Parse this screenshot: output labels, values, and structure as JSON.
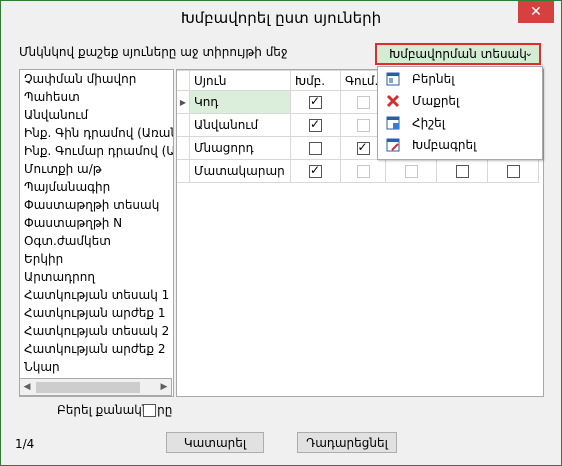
{
  "window": {
    "title": "Խմբավորել ըստ սյուների",
    "close_glyph": "✕"
  },
  "subtitle": "Մնկնկով քաշեք սյուները աջ տիրույթի մեջ",
  "group_type": {
    "label": "Խմբավորման տեսակ",
    "chevron": "⌄"
  },
  "group_menu": [
    {
      "label": "Բերնել",
      "icon": "layout-icon"
    },
    {
      "label": "Մաքրել",
      "icon": "red-x-icon"
    },
    {
      "label": "Հիշել",
      "icon": "save-grid-icon"
    },
    {
      "label": "Խմբագրել",
      "icon": "edit-grid-icon"
    }
  ],
  "left_columns": [
    "Չափման միավոր",
    "Պահեստ",
    "Անվանում",
    "Ինք. Գին դրամով (Առանձ",
    "Ինք. Գումար դրամով (Առ",
    "Մուտքի ա/թ",
    "Պայմանագիր",
    "Փաստաթղթի տեսակ",
    "Փաստաթղթի N",
    "Օգտ.ժամկետ",
    "Երկիր",
    "Արտադրող",
    "Հատկության տեսակ 1",
    "Հատկության արժեք 1",
    "Հատկության տեսակ 2",
    "Հատկության արժեք 2",
    "Նկար"
  ],
  "grid": {
    "headers": [
      "Սյուն",
      "Խմբ.",
      "Գում."
    ],
    "rows": [
      {
        "name": "Կոդ",
        "group": true,
        "sum": false,
        "sum_disabled": true,
        "extra1": false,
        "extra2": false,
        "selected": true
      },
      {
        "name": "Անվանում",
        "group": true,
        "sum": false,
        "sum_disabled": true,
        "extra1": false,
        "extra2": false,
        "selected": false
      },
      {
        "name": "Մնացորդ",
        "group": false,
        "sum": true,
        "sum_disabled": false,
        "extra1": false,
        "extra2": false,
        "selected": false
      },
      {
        "name": "Մատակարար",
        "group": true,
        "sum": false,
        "sum_disabled": true,
        "extra1": false,
        "extra2": false,
        "selected": false
      }
    ],
    "row_indicator": "▶"
  },
  "bring_quantities": {
    "label": "Բերել քանակները",
    "checked": false
  },
  "pager": "1/4",
  "buttons": {
    "ok": "Կատարել",
    "cancel": "Դադարեցնել"
  },
  "colors": {
    "accent_green": "#d4ebd4",
    "highlight_red": "#e32b2b",
    "close_red": "#d84040"
  }
}
